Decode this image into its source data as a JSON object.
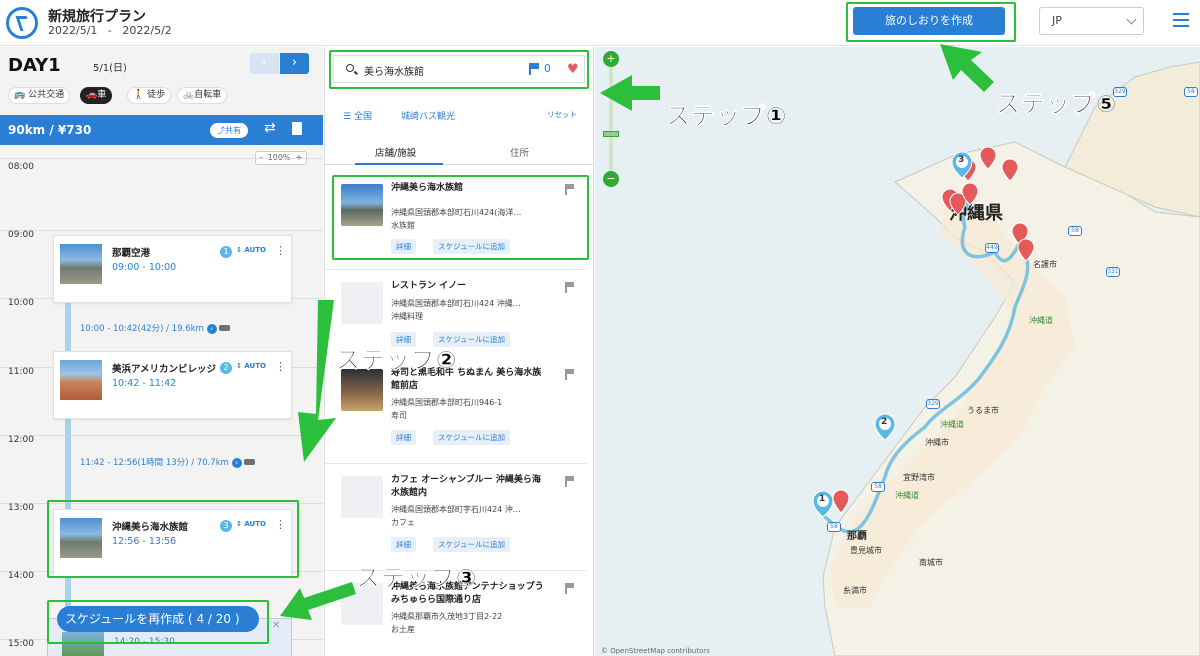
{
  "header": {
    "title": "新規旅行プラン",
    "date_start": "2022/5/1",
    "date_sep": "-",
    "date_end": "2022/5/2",
    "create_button": "旅のしおりを作成",
    "language": "JP"
  },
  "day": {
    "label": "DAY1",
    "date": "5/1(日)"
  },
  "modes": [
    "公共交通",
    "車",
    "徒歩",
    "自転車"
  ],
  "summary": {
    "distance_price": "90km / ¥730",
    "share": "共有"
  },
  "zoom": "100%",
  "hours": [
    "08:00",
    "09:00",
    "10:00",
    "11:00",
    "12:00",
    "13:00",
    "14:00",
    "15:00"
  ],
  "schedule": [
    {
      "name": "那覇空港",
      "time": "09:00 - 10:00",
      "num": "1",
      "auto": "AUTO"
    },
    {
      "name": "美浜アメリカンビレッジ",
      "time": "10:42 - 11:42",
      "num": "2",
      "auto": "AUTO"
    },
    {
      "name": "沖縄美ら海水族館",
      "time": "12:56 - 13:56",
      "num": "3",
      "auto": "AUTO"
    }
  ],
  "transits": [
    "10:00 - 10:42(42分) / 19.6km",
    "11:42 - 12:56(1時間 13分) / 70.7km"
  ],
  "reschedule": "スケジュールを再作成 ( 4 / 20 )",
  "card4_time": "14:20 - 15:30",
  "search": {
    "value": "美ら海水族館",
    "flag_count": "0"
  },
  "filters": {
    "all": "全国",
    "area": "城崎バス観光",
    "reset": "リセット"
  },
  "tabs": [
    "店舗/施設",
    "住所"
  ],
  "results": [
    {
      "name": "沖縄美ら海水族館",
      "addr": "沖縄県国頭郡本部町石川424(海洋…",
      "cat": "水族館",
      "detail": "詳細",
      "add": "スケジュールに追加"
    },
    {
      "name": "レストラン イノー",
      "addr": "沖縄県国頭郡本部町石川424 沖縄…",
      "cat": "沖縄料理",
      "detail": "詳細",
      "add": "スケジュールに追加"
    },
    {
      "name": "寿司と黒毛和牛 ちぬまん 美ら海水族館前店",
      "addr": "沖縄県国頭郡本部町石川946-1",
      "cat": "寿司",
      "detail": "詳細",
      "add": "スケジュールに追加"
    },
    {
      "name": "カフェ オーシャンブルー 沖縄美ら海水族館内",
      "addr": "沖縄県国頭郡本部町字石川424 沖…",
      "cat": "カフェ",
      "detail": "詳細",
      "add": "スケジュールに追加"
    },
    {
      "name": "沖縄美ら海水族館アンテナショップうみちゅらら国際通り店",
      "addr": "沖縄県那覇市久茂地3丁目2-22",
      "cat": "お土産"
    }
  ],
  "map": {
    "pref": "沖縄県",
    "labels": [
      "名護市",
      "うるま市",
      "沖縄市",
      "宜野湾市",
      "那覇",
      "豊見城市",
      "南城市",
      "糸満市",
      "沖縄道",
      "沖縄道",
      "沖縄道"
    ],
    "shields": [
      "58",
      "58",
      "58",
      "329",
      "329",
      "331",
      "449",
      "58"
    ],
    "markers": [
      "1",
      "2",
      "3"
    ],
    "copyright": "© OpenStreetMap contributors"
  },
  "annotations": {
    "step1": "ステップ①",
    "step2": "ステップ②",
    "step3": "ステップ③",
    "step5": "ステップ⑤"
  },
  "colors": {
    "accent": "#2a7fd4",
    "annotation": "#2bbf3c",
    "route": "#7ec3df",
    "pin": "#e45a5a"
  }
}
